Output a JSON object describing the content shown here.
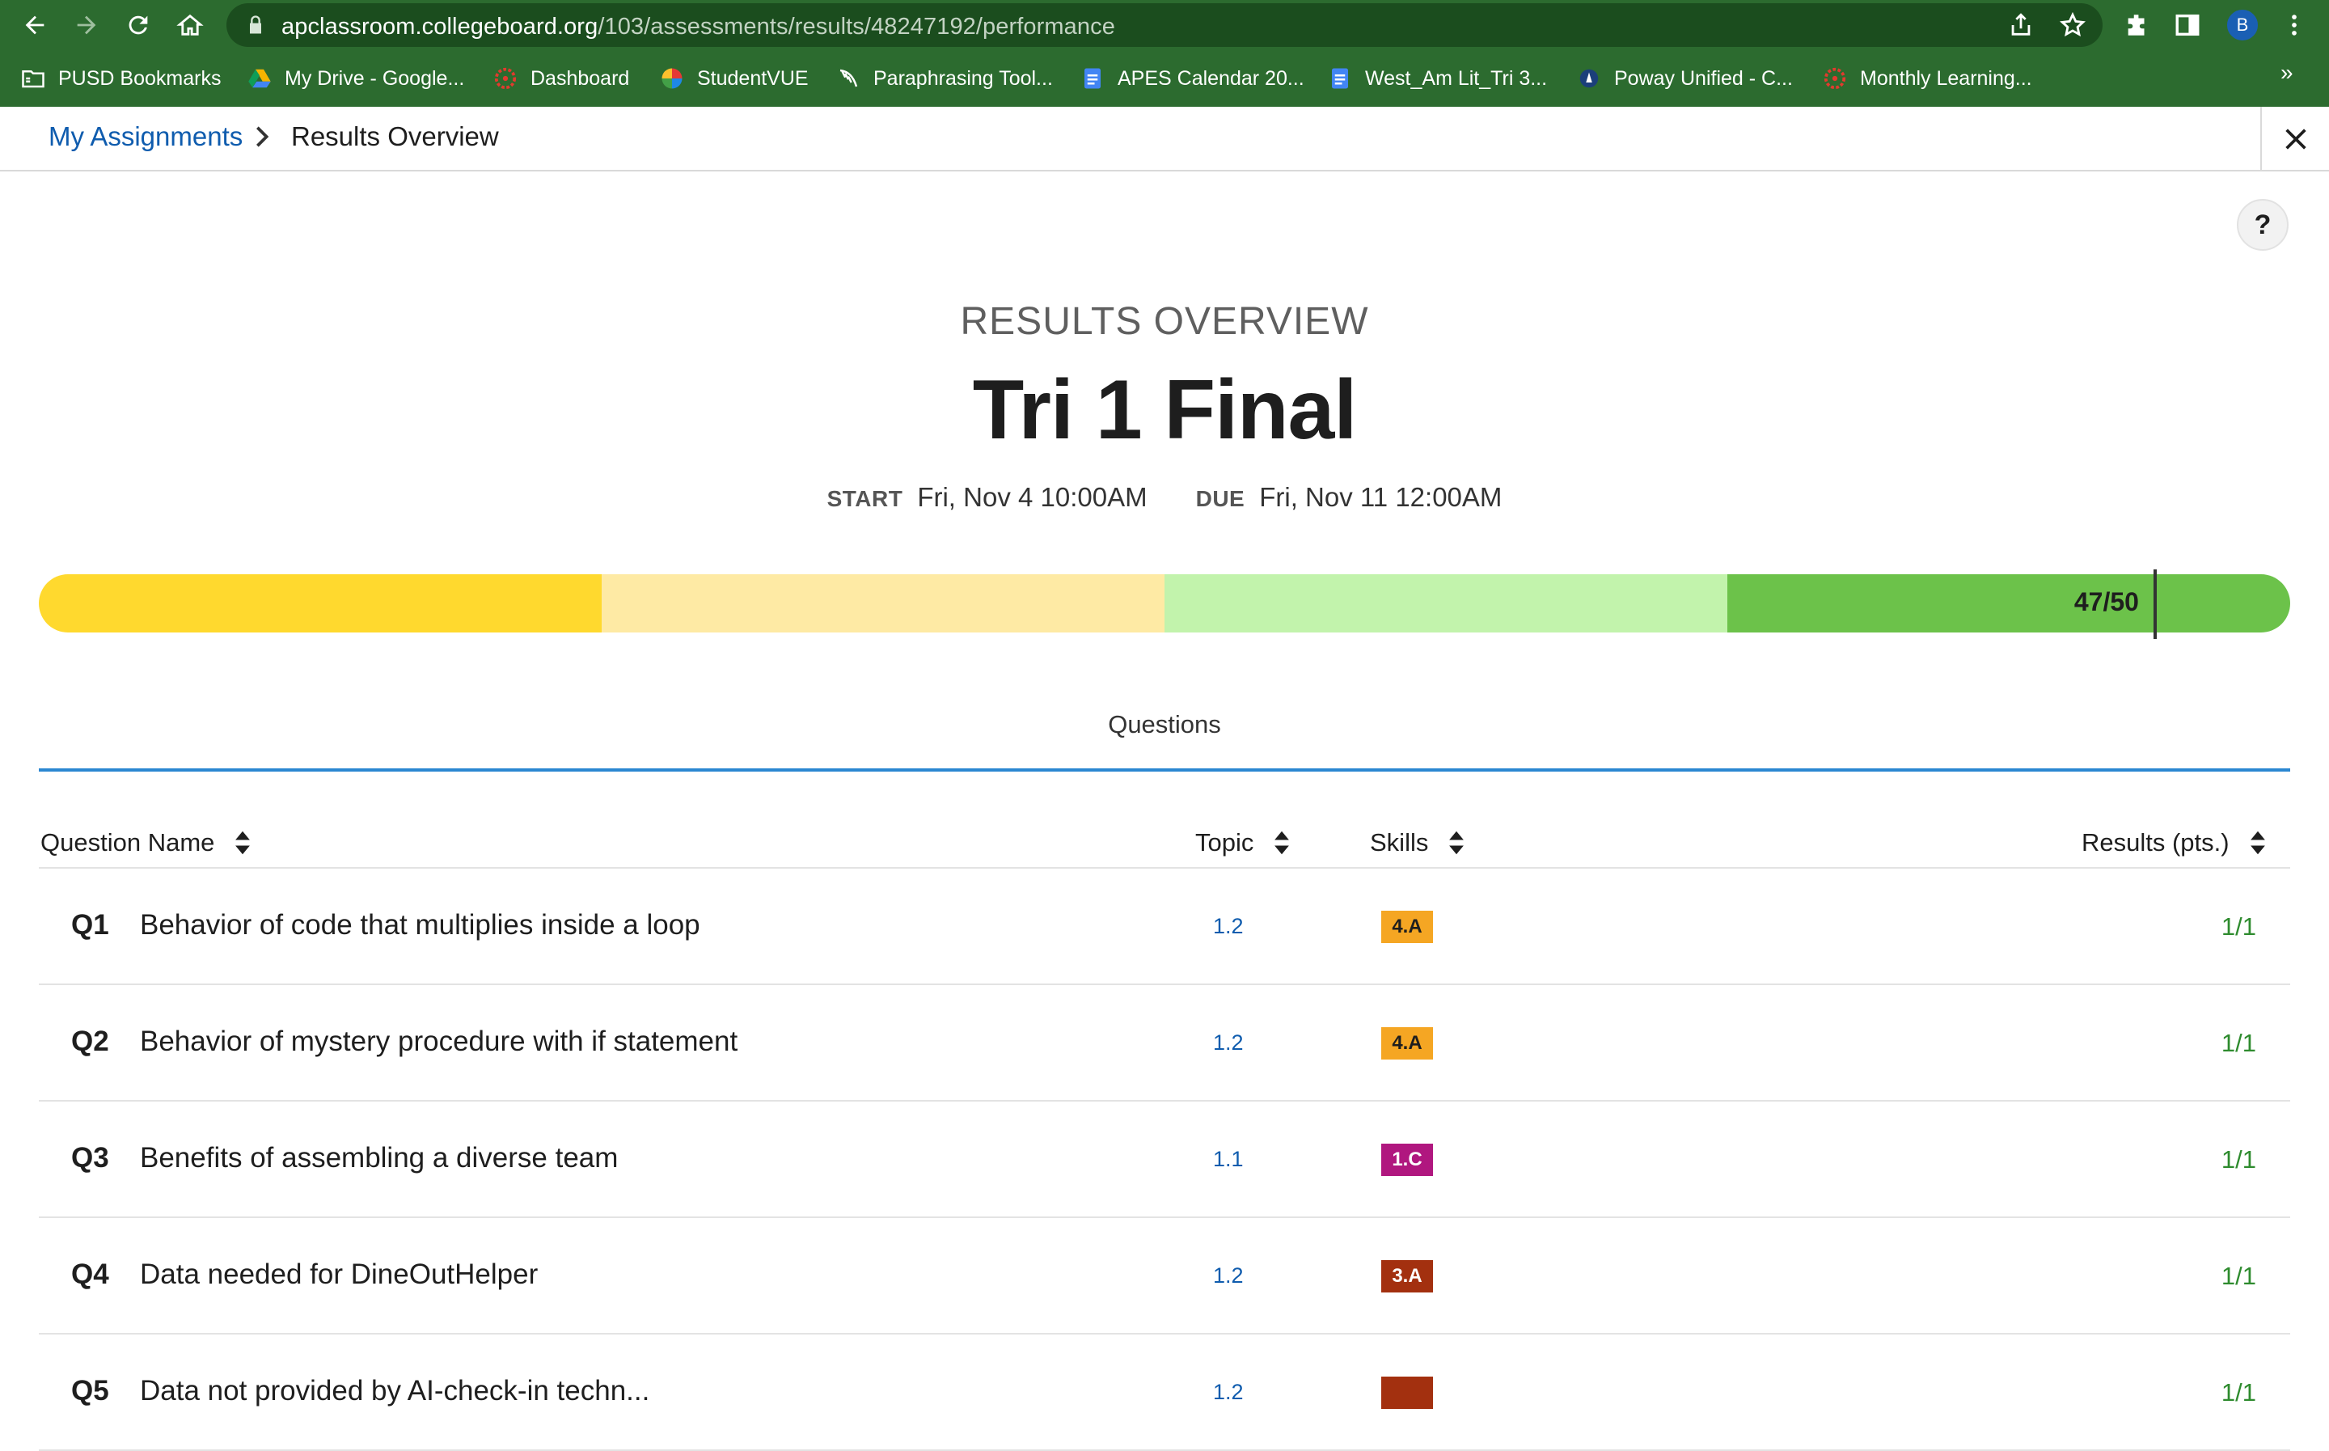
{
  "browser": {
    "url_domain": "apclassroom.collegeboard.org",
    "url_path": "/103/assessments/results/48247192/performance",
    "profile_initial": "B",
    "bookmarks": [
      {
        "label": "PUSD Bookmarks",
        "icon": "folder-icon"
      },
      {
        "label": "My Drive - Google...",
        "icon": "google-drive-icon"
      },
      {
        "label": "Dashboard",
        "icon": "canvas-icon"
      },
      {
        "label": "StudentVUE",
        "icon": "studentvue-icon"
      },
      {
        "label": "Paraphrasing Tool...",
        "icon": "feather-icon"
      },
      {
        "label": "APES Calendar 20...",
        "icon": "google-docs-icon"
      },
      {
        "label": "West_Am Lit_Tri 3...",
        "icon": "google-docs-icon"
      },
      {
        "label": "Poway Unified - C...",
        "icon": "district-icon"
      },
      {
        "label": "Monthly Learning...",
        "icon": "canvas-icon"
      }
    ],
    "more_bookmarks": "»"
  },
  "header": {
    "breadcrumb_link": "My Assignments",
    "breadcrumb_current": "Results Overview"
  },
  "help_label": "?",
  "overview": {
    "overline": "RESULTS OVERVIEW",
    "title": "Tri 1 Final",
    "start_label": "START",
    "start_value": "Fri, Nov 4 10:00AM",
    "due_label": "DUE",
    "due_value": "Fri, Nov 11 12:00AM"
  },
  "score": {
    "label": "47/50",
    "earned": 47,
    "total": 50,
    "segment_colors": [
      "#ffd92e",
      "#feeaa4",
      "#c2f3ac",
      "#6cc24a"
    ]
  },
  "tabs": [
    {
      "label": "Questions",
      "active": true
    }
  ],
  "colors": {
    "accent_blue": "#0f5cae",
    "tab_underline": "#2b87d1",
    "result_green": "#2e8b2e",
    "chrome_green": "#2c6b2f"
  },
  "table": {
    "columns": [
      "Question Name",
      "Topic",
      "Skills",
      "Results (pts.)"
    ],
    "rows": [
      {
        "num": "Q1",
        "name": "Behavior of code that multiplies inside a loop",
        "topic": "1.2",
        "skill": "4.A",
        "skill_bg": "#f5a623",
        "skill_fg": "#1e1e1e",
        "result": "1/1"
      },
      {
        "num": "Q2",
        "name": "Behavior of mystery procedure with if statement",
        "topic": "1.2",
        "skill": "4.A",
        "skill_bg": "#f5a623",
        "skill_fg": "#1e1e1e",
        "result": "1/1"
      },
      {
        "num": "Q3",
        "name": "Benefits of assembling a diverse team",
        "topic": "1.1",
        "skill": "1.C",
        "skill_bg": "#b0177f",
        "skill_fg": "#ffffff",
        "result": "1/1"
      },
      {
        "num": "Q4",
        "name": "Data needed for DineOutHelper",
        "topic": "1.2",
        "skill": "3.A",
        "skill_bg": "#a3300f",
        "skill_fg": "#ffffff",
        "result": "1/1"
      },
      {
        "num": "Q5",
        "name": "Data not provided by AI-check-in techn...",
        "topic": "1.2",
        "skill": "",
        "skill_bg": "#a3300f",
        "skill_fg": "#ffffff",
        "result": "1/1"
      }
    ]
  }
}
